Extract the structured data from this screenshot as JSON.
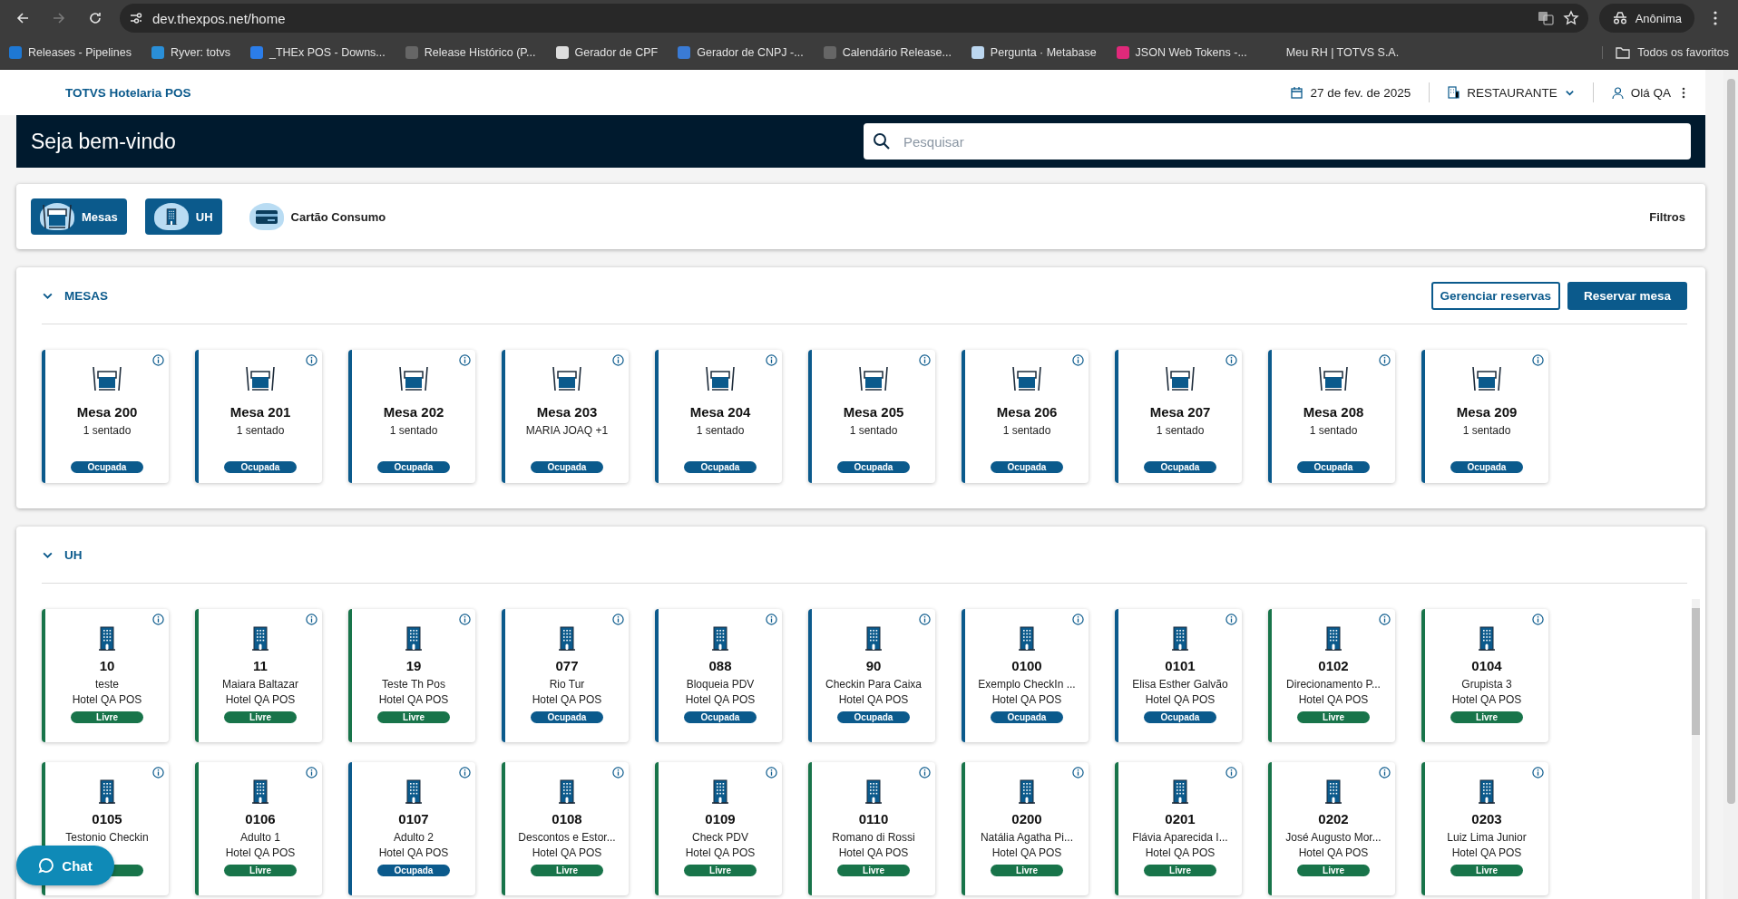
{
  "browser": {
    "url": "dev.thexpos.net/home",
    "profile": "Anônima",
    "bookmarks": [
      {
        "label": "Releases - Pipelines",
        "color": "#1e78d4"
      },
      {
        "label": "Ryver: totvs",
        "color": "#2a8fd8"
      },
      {
        "label": "_THEx POS - Downs...",
        "color": "#2b7de9"
      },
      {
        "label": "Release Histórico (P...",
        "color": "#666666"
      },
      {
        "label": "Gerador de CPF",
        "color": "#dddddd"
      },
      {
        "label": "Gerador de CNPJ -...",
        "color": "#3a7bd5"
      },
      {
        "label": "Calendário Release...",
        "color": "#666666"
      },
      {
        "label": "Pergunta · Metabase",
        "color": "#bcd7f0"
      },
      {
        "label": "JSON Web Tokens -...",
        "color": "#e0297a"
      },
      {
        "label": "Meu RH | TOTVS S.A."
      }
    ],
    "all_bookmarks": "Todos os favoritos"
  },
  "app": {
    "brand": "TOTVS Hotelaria POS",
    "date": "27 de fev. de 2025",
    "outlet": "RESTAURANTE",
    "user": "Olá QA"
  },
  "banner": {
    "title": "Seja bem-vindo",
    "search": {
      "placeholder": "Pesquisar"
    }
  },
  "filters": {
    "items": [
      {
        "label": "Mesas",
        "kind": "table",
        "selected": true
      },
      {
        "label": "UH",
        "kind": "building",
        "selected": true
      },
      {
        "label": "Cartão Consumo",
        "kind": "card",
        "selected": false
      }
    ],
    "action": "Filtros"
  },
  "sections": [
    {
      "title": "MESAS",
      "expanded": true,
      "buttons": [
        {
          "label": "Gerenciar reservas",
          "kind": "outline"
        },
        {
          "label": "Reservar mesa",
          "kind": "filled"
        }
      ],
      "cards": [
        {
          "kind": "table",
          "name": "Mesa 200",
          "detail": "1 sentado",
          "status": "Ocupada"
        },
        {
          "kind": "table",
          "name": "Mesa 201",
          "detail": "1 sentado",
          "status": "Ocupada"
        },
        {
          "kind": "table",
          "name": "Mesa 202",
          "detail": "1 sentado",
          "status": "Ocupada"
        },
        {
          "kind": "table",
          "name": "Mesa 203",
          "detail": "MARIA JOAQ +1",
          "status": "Ocupada"
        },
        {
          "kind": "table",
          "name": "Mesa 204",
          "detail": "1 sentado",
          "status": "Ocupada"
        },
        {
          "kind": "table",
          "name": "Mesa 205",
          "detail": "1 sentado",
          "status": "Ocupada"
        },
        {
          "kind": "table",
          "name": "Mesa 206",
          "detail": "1 sentado",
          "status": "Ocupada"
        },
        {
          "kind": "table",
          "name": "Mesa 207",
          "detail": "1 sentado",
          "status": "Ocupada"
        },
        {
          "kind": "table",
          "name": "Mesa 208",
          "detail": "1 sentado",
          "status": "Ocupada"
        },
        {
          "kind": "table",
          "name": "Mesa 209",
          "detail": "1 sentado",
          "status": "Ocupada"
        }
      ]
    },
    {
      "title": "UH",
      "expanded": true,
      "scrollbar": true,
      "cards": [
        {
          "kind": "room",
          "name": "10",
          "detail": "teste",
          "hotel": "Hotel QA POS",
          "status": "Livre"
        },
        {
          "kind": "room",
          "name": "11",
          "detail": "Maiara Baltazar",
          "hotel": "Hotel QA POS",
          "status": "Livre"
        },
        {
          "kind": "room",
          "name": "19",
          "detail": "Teste Th Pos",
          "hotel": "Hotel QA POS",
          "status": "Livre"
        },
        {
          "kind": "room",
          "name": "077",
          "detail": "Rio Tur",
          "hotel": "Hotel QA POS",
          "status": "Ocupada"
        },
        {
          "kind": "room",
          "name": "088",
          "detail": "Bloqueia PDV",
          "hotel": "Hotel QA POS",
          "status": "Ocupada"
        },
        {
          "kind": "room",
          "name": "90",
          "detail": "Checkin Para Caixa",
          "hotel": "Hotel QA POS",
          "status": "Ocupada"
        },
        {
          "kind": "room",
          "name": "0100",
          "detail": "Exemplo CheckIn ...",
          "hotel": "Hotel QA POS",
          "status": "Ocupada"
        },
        {
          "kind": "room",
          "name": "0101",
          "detail": "Elisa Esther Galvão",
          "hotel": "Hotel QA POS",
          "status": "Ocupada"
        },
        {
          "kind": "room",
          "name": "0102",
          "detail": "Direcionamento P...",
          "hotel": "Hotel QA POS",
          "status": "Livre"
        },
        {
          "kind": "room",
          "name": "0104",
          "detail": "Grupista 3",
          "hotel": "Hotel QA POS",
          "status": "Livre"
        },
        {
          "kind": "room",
          "name": "0105",
          "detail": "Testonio Checkin",
          "color": "#18744a"
        },
        {
          "kind": "room",
          "name": "0106",
          "detail": "Adulto 1",
          "hotel": "Hotel QA POS",
          "status": "Livre"
        },
        {
          "kind": "room",
          "name": "0107",
          "detail": "Adulto 2",
          "hotel": "Hotel QA POS",
          "status": "Ocupada"
        },
        {
          "kind": "room",
          "name": "0108",
          "detail": "Descontos e Estor...",
          "hotel": "Hotel QA POS",
          "status": "Livre"
        },
        {
          "kind": "room",
          "name": "0109",
          "detail": "Check PDV",
          "hotel": "Hotel QA POS",
          "status": "Livre"
        },
        {
          "kind": "room",
          "name": "0110",
          "detail": "Romano di Rossi",
          "hotel": "Hotel QA POS",
          "status": "Livre"
        },
        {
          "kind": "room",
          "name": "0200",
          "detail": "Natália Agatha Pi...",
          "hotel": "Hotel QA POS",
          "status": "Livre"
        },
        {
          "kind": "room",
          "name": "0201",
          "detail": "Flávia Aparecida I...",
          "hotel": "Hotel QA POS",
          "status": "Livre"
        },
        {
          "kind": "room",
          "name": "0202",
          "detail": "José Augusto Mor...",
          "hotel": "Hotel QA POS",
          "status": "Livre"
        },
        {
          "kind": "room",
          "name": "0203",
          "detail": "Luiz Lima Junior",
          "hotel": "Hotel QA POS",
          "status": "Livre"
        }
      ]
    }
  ],
  "chat": {
    "label": "Chat"
  }
}
